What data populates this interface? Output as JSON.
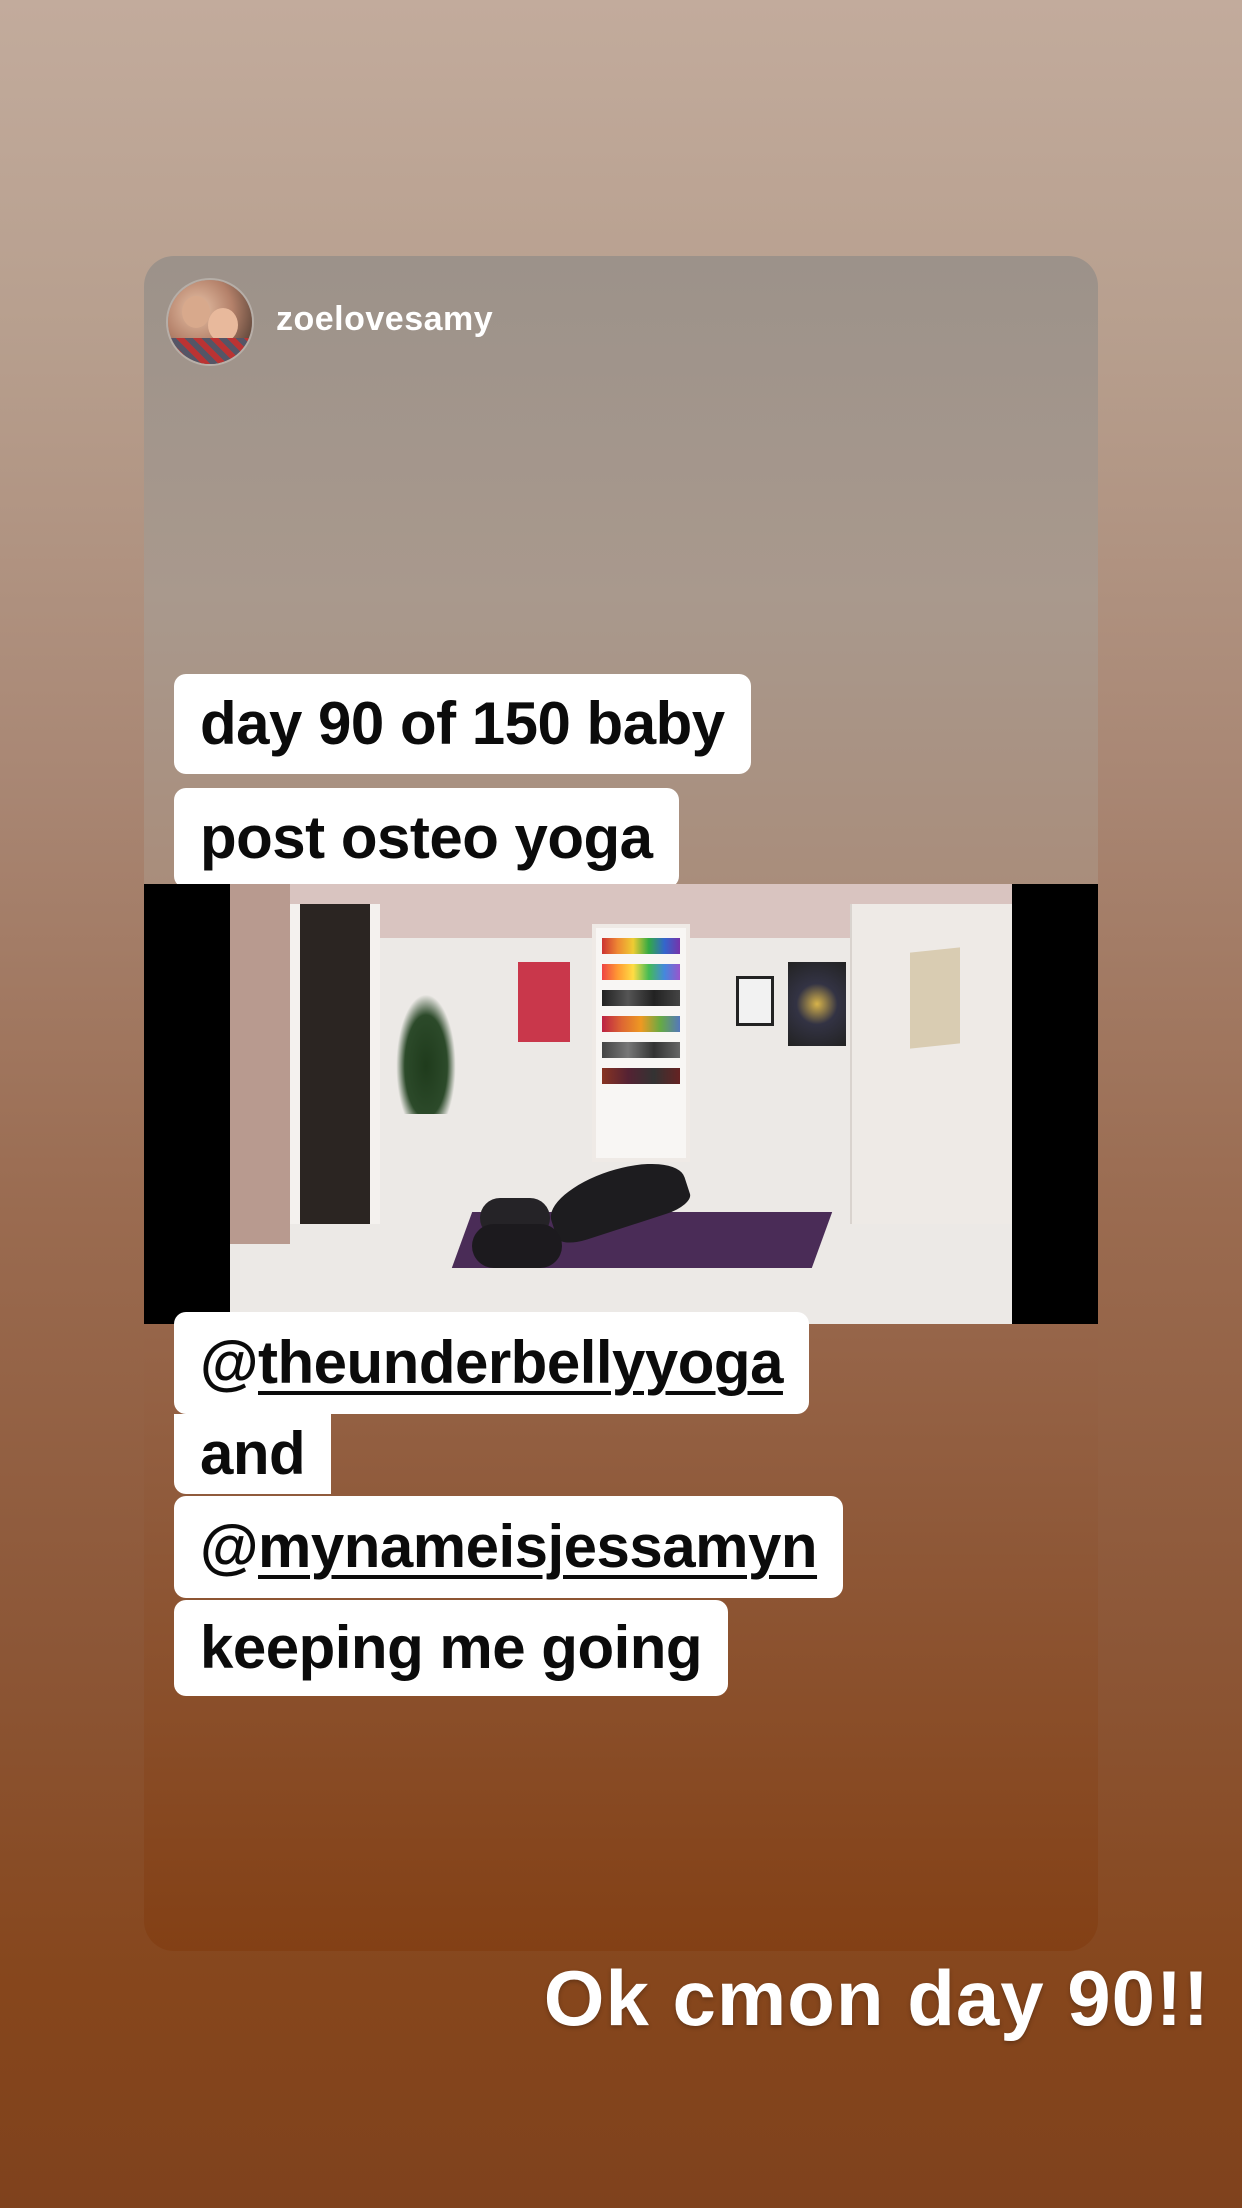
{
  "story": {
    "username": "zoelovesamy",
    "text_lines": [
      "day 90 of 150 baby",
      "post osteo yoga"
    ],
    "mention_block": {
      "line1_prefix": "@",
      "line1_handle": "theunderbellyyoga",
      "line2": "and",
      "line3_prefix": "@",
      "line3_handle": "mynameisjessamyn",
      "line4": "keeping me going"
    }
  },
  "caption": "Ok cmon day 90!!",
  "colors": {
    "chip_background": "#ffffff",
    "chip_text": "#0b0b0b",
    "caption_text": "#ffffff",
    "video_letterbox": "#000000"
  }
}
